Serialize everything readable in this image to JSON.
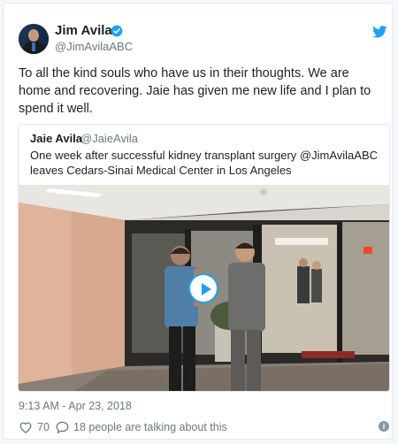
{
  "author": {
    "name": "Jim Avila",
    "handle": "@JimAvilaABC",
    "verified": true
  },
  "tweet": {
    "text": "To all the kind souls who have us in their thoughts. We are home and recovering.  Jaie has given me new life and I plan to spend it well."
  },
  "quoted": {
    "name": "Jaie Avila",
    "handle": "@JaieAvila",
    "text": "One week after successful kidney transplant surgery @JimAvilaABC leaves Cedars-Sinai Medical Center in Los Angeles"
  },
  "timestamp": "9:13 AM - Apr 23, 2018",
  "engagement": {
    "likes": "70",
    "talking": "18 people are talking about this"
  },
  "icons": {
    "brand": "twitter-bird-icon",
    "like": "heart-icon",
    "reply": "speech-bubble-icon",
    "info": "info-icon",
    "play": "play-icon"
  },
  "colors": {
    "accent": "#1da1f2",
    "text": "#1c2022",
    "muted": "#697882"
  }
}
